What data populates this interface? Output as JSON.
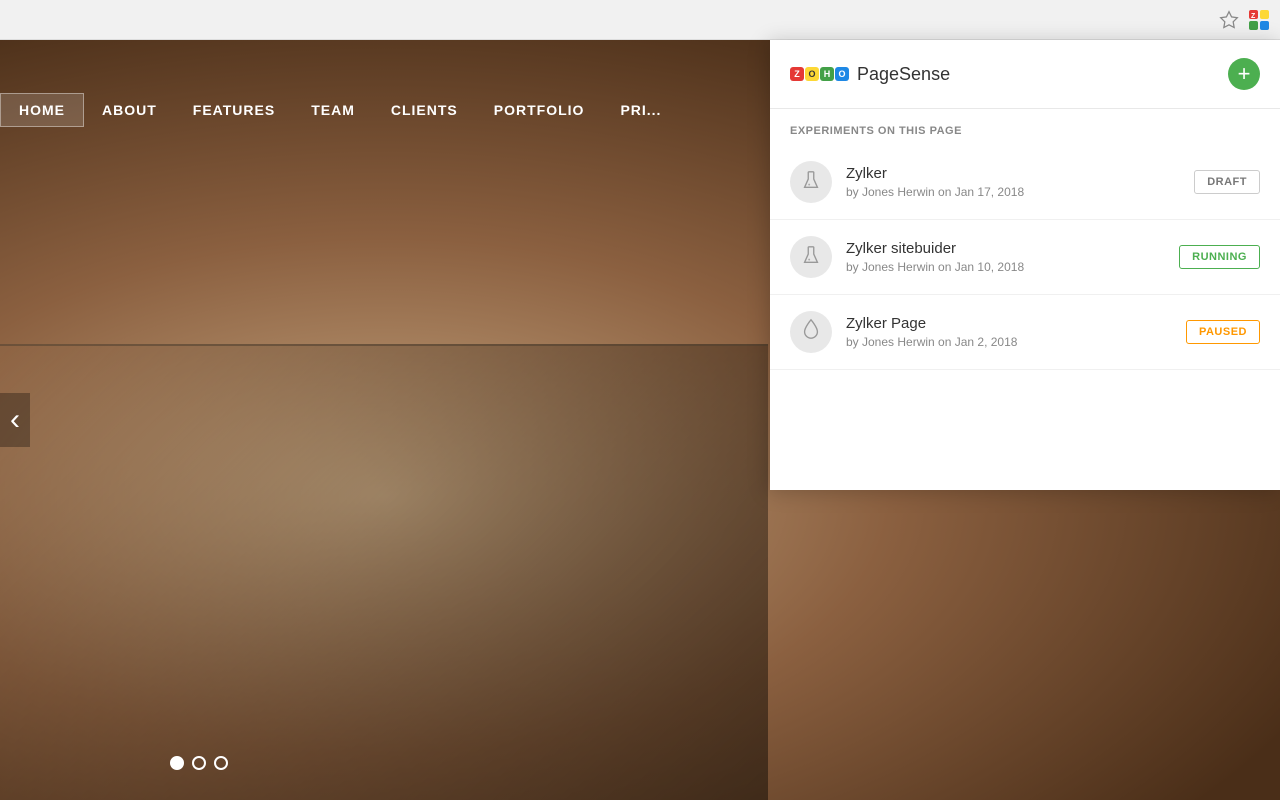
{
  "browser": {
    "star_icon": "★",
    "extension_icon": "🗂"
  },
  "website": {
    "nav_items": [
      {
        "label": "HOME",
        "active": true
      },
      {
        "label": "ABOUT",
        "active": false
      },
      {
        "label": "FEATURES",
        "active": false
      },
      {
        "label": "TEAM",
        "active": false
      },
      {
        "label": "CLIENTS",
        "active": false
      },
      {
        "label": "PORTFOLIO",
        "active": false
      },
      {
        "label": "PRI...",
        "active": false
      }
    ],
    "dots": [
      {
        "active": true
      },
      {
        "active": false
      },
      {
        "active": false
      }
    ]
  },
  "panel": {
    "logo_text": "ZOHO",
    "title": "PageSense",
    "add_button_label": "+",
    "section_title": "EXPERIMENTS ON THIS PAGE",
    "experiments": [
      {
        "name": "Zylker",
        "meta": "by Jones Herwin on Jan 17, 2018",
        "status": "DRAFT",
        "status_type": "draft",
        "icon_type": "flask"
      },
      {
        "name": "Zylker sitebuider",
        "meta": "by Jones Herwin on Jan 10, 2018",
        "status": "RUNNING",
        "status_type": "running",
        "icon_type": "flask"
      },
      {
        "name": "Zylker Page",
        "meta": "by Jones Herwin on Jan 2, 2018",
        "status": "PAUSED",
        "status_type": "paused",
        "icon_type": "drop"
      }
    ]
  }
}
